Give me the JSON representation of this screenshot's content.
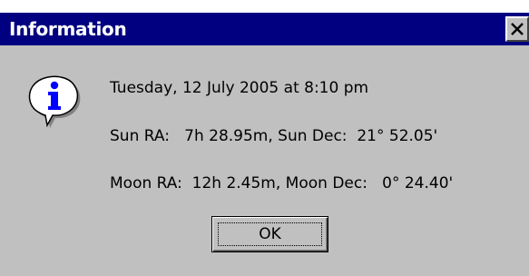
{
  "dialog": {
    "title": "Information",
    "close_glyph": "✕",
    "icon": "info-icon",
    "lines": [
      "Tuesday, 12 July 2005 at 8:10 pm",
      "Sun RA:   7h 28.95m, Sun Dec:  21° 52.05'",
      "Moon RA:  12h 2.45m, Moon Dec:   0° 24.40'"
    ],
    "ok_label": "OK"
  },
  "colors": {
    "titlebar": "#000080",
    "face": "#c0c0c0"
  }
}
